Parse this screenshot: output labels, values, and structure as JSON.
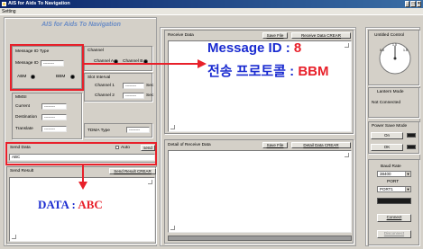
{
  "window": {
    "title": "AIS for Aids To Navigation",
    "menu_setting": "Setting",
    "min": "_",
    "max": "□",
    "close": "×"
  },
  "left": {
    "heading": "AIS for Aids To Navigation",
    "message_id_type": {
      "label": "Message ID Type",
      "message_id_label": "Message ID",
      "message_id_value": "--------",
      "abm_label": "ABM",
      "bbm_label": "BBM"
    },
    "channel": {
      "label": "Channel",
      "channel_a": "Channel A",
      "channel_b": "Channel B"
    },
    "slot_interval": {
      "label": "Slot Interval",
      "channel1_label": "Channel 1",
      "channel1_value": "--------",
      "channel1_unit": "Sec",
      "channel2_label": "Channel 2",
      "channel2_value": "--------",
      "channel2_unit": "Sec"
    },
    "mmsi": {
      "label": "MMSI",
      "current_label": "Current",
      "current_value": "--------",
      "destination_label": "Destination",
      "destination_value": "--------",
      "translate_label": "Translate",
      "translate_value": "--------"
    },
    "tdma": {
      "label": "TDMA Type",
      "value": "--------"
    },
    "send_data": {
      "label": "Send Data",
      "auto_label": "Auto",
      "send_button": "send",
      "value": "ABC"
    },
    "send_result": {
      "label": "Send Result",
      "clear_button": "Send Result CREAR"
    }
  },
  "center": {
    "receive_data": {
      "label": "Receive Data",
      "save_button": "Save File",
      "clear_button": "Receive Data CREAR"
    },
    "detail": {
      "label": "Detail of Receive Data",
      "save_button": "Save File",
      "clear_button": "Detail Data CREAR"
    }
  },
  "right": {
    "untitled_control": "Untitled Control",
    "gauge_labels": {
      "left": "0.5",
      "top": "1.0",
      "right": "1.5"
    },
    "lantern_mode": {
      "label": "Lantern Mode",
      "value": "Not Connected"
    },
    "power_save": {
      "label": "Power Save Mode",
      "on_button": "On",
      "ok_button": "OK"
    },
    "baud": {
      "label": "Baud Rate",
      "value": "38400",
      "port_label": "PORT",
      "port_value": "PORT1",
      "connect_button": "Connect",
      "disconnect_button": "Disconnect"
    }
  },
  "annotations": {
    "message_id_prefix": "Message ID : ",
    "message_id_value": "8",
    "protocol_prefix": "전송 프로토콜 : ",
    "protocol_value": "BBM",
    "data_prefix": "DATA : ",
    "data_value": "ABC"
  },
  "colors": {
    "annotation_text": "#1a2bd0",
    "annotation_value": "#e8202a",
    "highlight": "#e8202a",
    "title_bar": "#0a246a"
  }
}
